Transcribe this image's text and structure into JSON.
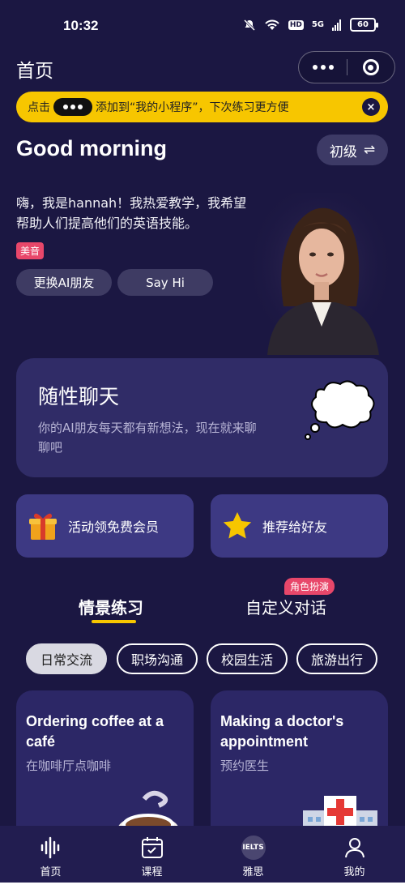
{
  "status_bar": {
    "time": "10:32",
    "hd": "HD",
    "network": "5G",
    "battery": "60"
  },
  "header": {
    "title": "首页"
  },
  "tip": {
    "prefix": "点击",
    "suffix": "添加到“我的小程序”，下次练习更方便",
    "close": "×"
  },
  "greeting": {
    "text": "Good morning",
    "level": "初级",
    "level_icon": "⇌"
  },
  "intro": {
    "text": "嗨，我是hannah！我热爱教学，我希望帮助人们提高他们的英语技能。",
    "accent": "美音",
    "change_friend": "更换AI朋友",
    "say_hi": "Say Hi"
  },
  "free_chat": {
    "title": "随性聊天",
    "desc": "你的AI朋友每天都有新想法，现在就来聊聊吧"
  },
  "promos": [
    {
      "icon": "gift-icon",
      "label": "活动领免费会员"
    },
    {
      "icon": "star-icon",
      "label": "推荐给好友"
    }
  ],
  "tabs": {
    "scene": "情景练习",
    "custom": "自定义对话",
    "role_tag": "角色扮演"
  },
  "chips": [
    "日常交流",
    "职场沟通",
    "校园生活",
    "旅游出行"
  ],
  "scenes": [
    {
      "en": "Ordering coffee at a café",
      "zh": "在咖啡厅点咖啡"
    },
    {
      "en": "Making a doctor's appointment",
      "zh": "预约医生"
    }
  ],
  "nav": [
    {
      "label": "首页",
      "icon": "sound-wave-icon"
    },
    {
      "label": "课程",
      "icon": "calendar-icon"
    },
    {
      "label": "雅思",
      "icon": "ielts-icon",
      "badge": "IELTS"
    },
    {
      "label": "我的",
      "icon": "profile-icon"
    }
  ],
  "colors": {
    "background": "#1b1742",
    "banner": "#f7c600",
    "accent_pink": "#e8476a",
    "card": "#302c67"
  }
}
